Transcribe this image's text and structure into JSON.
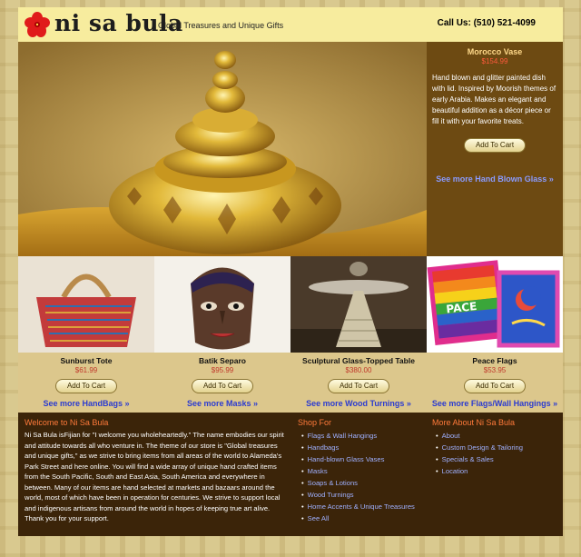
{
  "header": {
    "logo_text": "ni sa bula",
    "tagline": "Global Treasures and Unique Gifts",
    "phone": "Call  Us: (510) 521-4099"
  },
  "featured": {
    "title": "Morocco Vase",
    "price": "$154.99",
    "description": "Hand blown and glitter painted dish with lid. Inspired by Moorish themes of early Arabia.  Makes an elegant and beautiful addition as a décor piece or fill it with your favorite treats.",
    "cart_label": "Add To Cart",
    "more_link": "See more Hand Blown Glass »"
  },
  "products": [
    {
      "name": "Sunburst Tote",
      "price": "$61.99",
      "cart_label": "Add To Cart",
      "more": "See more HandBags »"
    },
    {
      "name": "Batik Separo",
      "price": "$95.99",
      "cart_label": "Add To Cart",
      "more": "See more Masks »"
    },
    {
      "name": "Sculptural Glass-Topped Table",
      "price": "$380.00",
      "cart_label": "Add To Cart",
      "more": "See more Wood Turnings »"
    },
    {
      "name": "Peace Flags",
      "price": "$53.95",
      "cart_label": "Add To Cart",
      "more": "See more Flags/Wall Hangings »"
    }
  ],
  "peace_flag_word": "PACE",
  "footer": {
    "welcome_title": "Welcome to Ni Sa Bula",
    "welcome_text": "Ni Sa Bula isFijian for \"I welcome you wholeheartedly.\" The name embodies our spirit and attitude towards all who venture in. The theme of our store is \"Global treasures and unique gifts,\" as we strive to bring items from all areas of the world to Alameda's Park Street and here online. You will find a wide array of unique hand crafted items from the South Pacific, South and East Asia, South America and everywhere in between. Many of our items are hand selected at markets and bazaars around the world, most of which have been in operation for centuries. We strive to support local and indigenous artisans from around the world in hopes of keeping true art alive. Thank you for your support.",
    "shop_title": "Shop For",
    "shop_items": [
      "Flags & Wall Hangings",
      "Handbags",
      "Hand-blown Glass Vases",
      "Masks",
      "Soaps & Lotions",
      "Wood Turnings",
      "Home Accents & Unique Treasures",
      "See All"
    ],
    "about_title": "More About Ni Sa Bula",
    "about_items": [
      "About",
      "Custom Design & Tailoring",
      "Specials & Sales",
      "Location"
    ]
  },
  "colors": {
    "header_bg": "#f7ec9e",
    "featured_bg": "#6d4a12",
    "footer_bg": "#3b2409",
    "price_red": "#c0392b",
    "link_blue": "#2b3bd0",
    "accent_orange": "#ff7a3a"
  }
}
